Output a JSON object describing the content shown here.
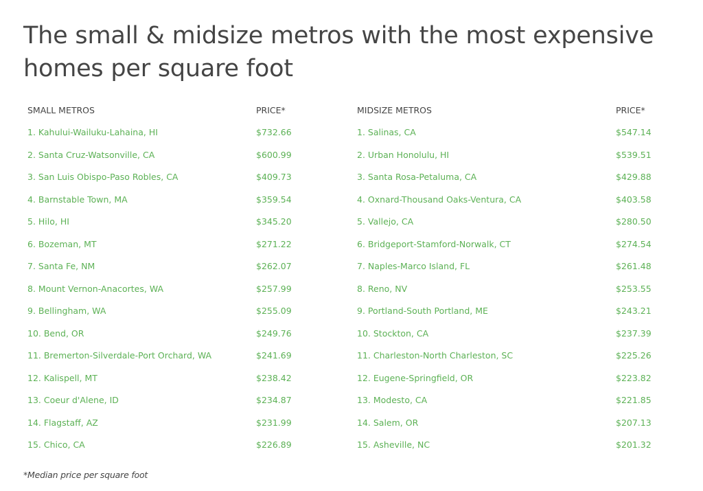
{
  "title": "The small & midsize metros with the most expensive homes per square foot",
  "headers": {
    "small_metros": "SMALL METROS",
    "small_price": "PRICE*",
    "midsize_metros": "MIDSIZE METROS",
    "midsize_price": "PRICE*"
  },
  "rows": [
    {
      "small": "1. Kahului-Wailuku-Lahaina, HI",
      "small_price": "$732.66",
      "midsize": "1. Salinas, CA",
      "midsize_price": "$547.14"
    },
    {
      "small": "2. Santa Cruz-Watsonville, CA",
      "small_price": "$600.99",
      "midsize": "2. Urban Honolulu, HI",
      "midsize_price": "$539.51"
    },
    {
      "small": "3. San Luis Obispo-Paso Robles, CA",
      "small_price": "$409.73",
      "midsize": "3. Santa Rosa-Petaluma, CA",
      "midsize_price": "$429.88"
    },
    {
      "small": "4. Barnstable Town, MA",
      "small_price": "$359.54",
      "midsize": "4. Oxnard-Thousand Oaks-Ventura, CA",
      "midsize_price": "$403.58"
    },
    {
      "small": "5. Hilo, HI",
      "small_price": "$345.20",
      "midsize": "5. Vallejo, CA",
      "midsize_price": "$280.50"
    },
    {
      "small": "6. Bozeman, MT",
      "small_price": "$271.22",
      "midsize": "6. Bridgeport-Stamford-Norwalk, CT",
      "midsize_price": "$274.54"
    },
    {
      "small": "7. Santa Fe, NM",
      "small_price": "$262.07",
      "midsize": "7. Naples-Marco Island, FL",
      "midsize_price": "$261.48"
    },
    {
      "small": "8. Mount Vernon-Anacortes, WA",
      "small_price": "$257.99",
      "midsize": "8. Reno, NV",
      "midsize_price": "$253.55"
    },
    {
      "small": "9. Bellingham, WA",
      "small_price": "$255.09",
      "midsize": "9. Portland-South Portland, ME",
      "midsize_price": "$243.21"
    },
    {
      "small": "10. Bend, OR",
      "small_price": "$249.76",
      "midsize": "10. Stockton, CA",
      "midsize_price": "$237.39"
    },
    {
      "small": "11. Bremerton-Silverdale-Port Orchard, WA",
      "small_price": "$241.69",
      "midsize": "11. Charleston-North Charleston, SC",
      "midsize_price": "$225.26"
    },
    {
      "small": "12. Kalispell, MT",
      "small_price": "$238.42",
      "midsize": "12. Eugene-Springfield, OR",
      "midsize_price": "$223.82"
    },
    {
      "small": "13. Coeur d'Alene, ID",
      "small_price": "$234.87",
      "midsize": "13. Modesto, CA",
      "midsize_price": "$221.85"
    },
    {
      "small": "14. Flagstaff, AZ",
      "small_price": "$231.99",
      "midsize": "14. Salem, OR",
      "midsize_price": "$207.13"
    },
    {
      "small": "15. Chico, CA",
      "small_price": "$226.89",
      "midsize": "15. Asheville, NC",
      "midsize_price": "$201.32"
    }
  ],
  "footnote": "*Median price per square foot",
  "colors": {
    "title": "#454545",
    "header": "#444444",
    "row_text": "#5cb155"
  }
}
